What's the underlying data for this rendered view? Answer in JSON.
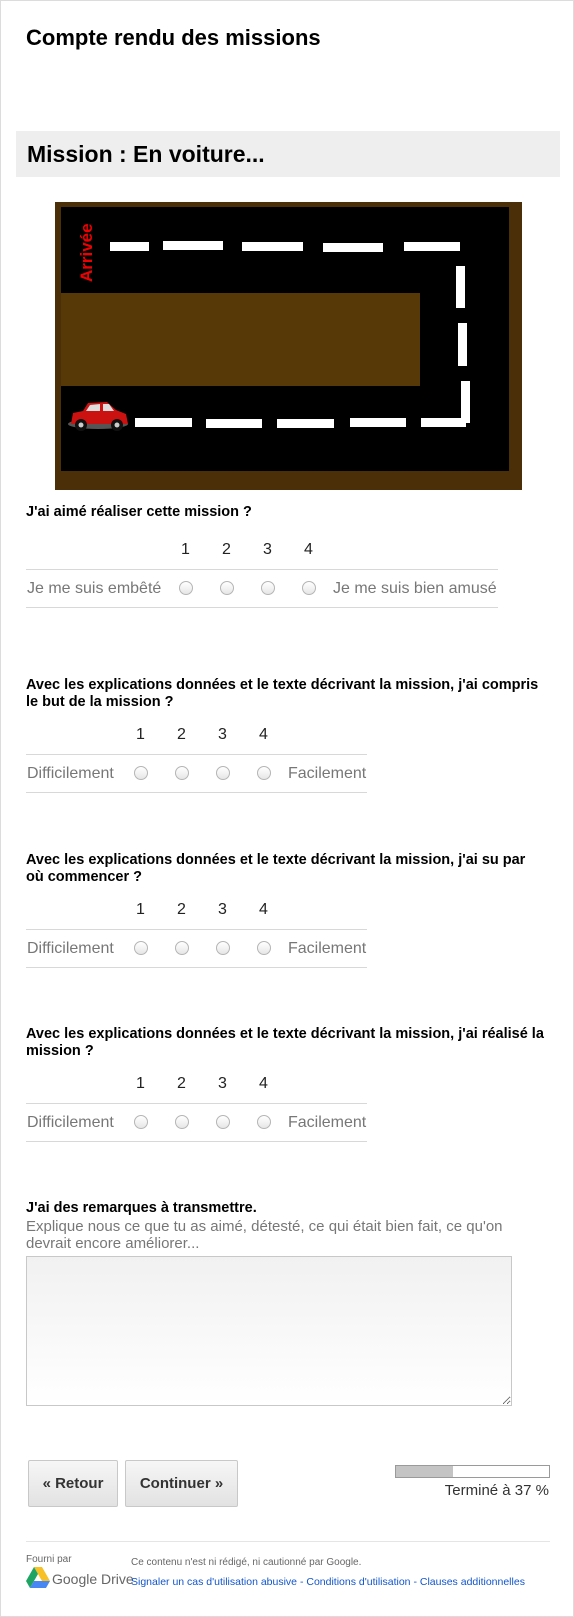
{
  "form": {
    "title": "Compte rendu des missions",
    "section_title": "Mission : En voiture..."
  },
  "mission_image": {
    "finish_label": "Arrivée",
    "colors": {
      "frame": "#4a2f08",
      "track": "#000000",
      "inner_block": "#573907",
      "dash": "#ffffff",
      "car": "#cc1111",
      "finish": "#ee0000"
    }
  },
  "questions": [
    {
      "title": "J'ai aimé réaliser cette mission ?",
      "scale": [
        "1",
        "2",
        "3",
        "4"
      ],
      "low_label": "Je me suis embêté",
      "high_label": "Je me suis bien amusé"
    },
    {
      "title": "Avec les explications données et le texte décrivant la mission, j'ai compris le but de la mission ?",
      "scale": [
        "1",
        "2",
        "3",
        "4"
      ],
      "low_label": "Difficilement",
      "high_label": "Facilement"
    },
    {
      "title": "Avec les explications données et le texte décrivant la mission, j'ai su par où commencer ?",
      "scale": [
        "1",
        "2",
        "3",
        "4"
      ],
      "low_label": "Difficilement",
      "high_label": "Facilement"
    },
    {
      "title": "Avec les explications données et le texte décrivant la mission, j'ai réalisé la mission ?",
      "scale": [
        "1",
        "2",
        "3",
        "4"
      ],
      "low_label": "Difficilement",
      "high_label": "Facilement"
    }
  ],
  "remarks": {
    "title": "J'ai des remarques à transmettre.",
    "help": "Explique nous ce que tu as aimé, détesté, ce qui était bien fait, ce qu'on devrait encore améliorer...",
    "value": ""
  },
  "navigation": {
    "back_label": "« Retour",
    "continue_label": "Continuer »"
  },
  "progress": {
    "fraction": 0.37,
    "label": "Terminé à 37 %"
  },
  "footer": {
    "provided_by": "Fourni par",
    "brand": "Google Drive",
    "disclaimer": "Ce contenu n'est ni rédigé, ni cautionné par Google.",
    "links": [
      "Signaler un cas d'utilisation abusive",
      "Conditions d'utilisation",
      "Clauses additionnelles"
    ],
    "separator": " - "
  }
}
